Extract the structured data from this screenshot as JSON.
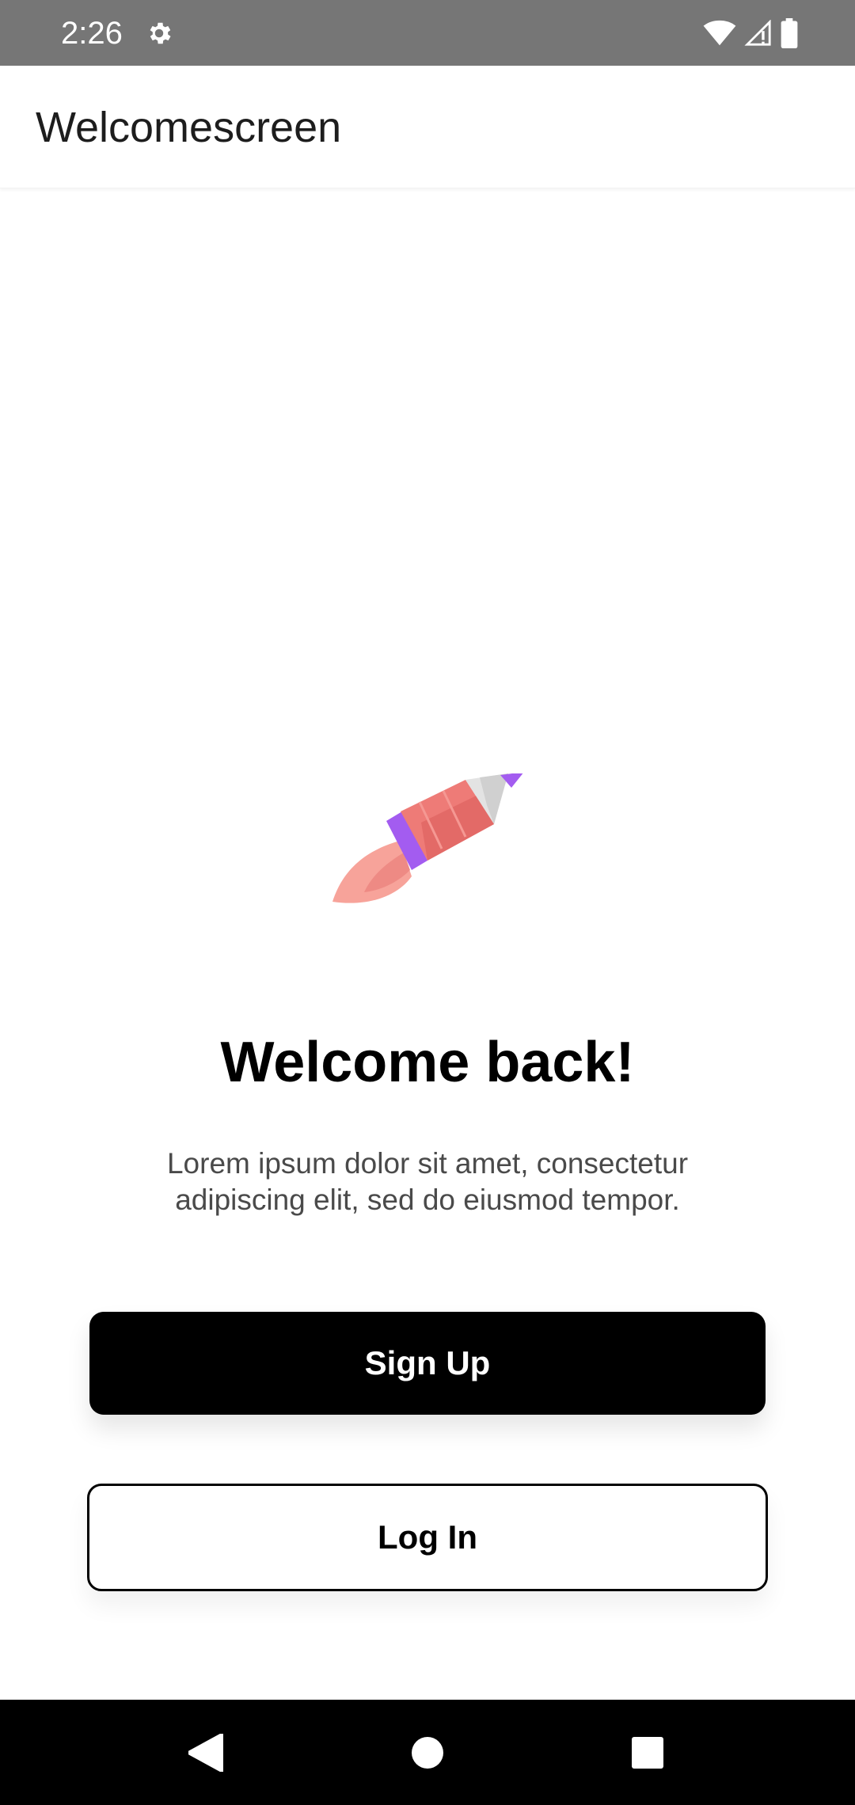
{
  "status_bar": {
    "time": "2:26",
    "settings_icon": "gear-icon",
    "wifi_icon": "wifi-icon",
    "signal_icon": "signal-icon",
    "battery_icon": "battery-icon"
  },
  "app_bar": {
    "title": "Welcomescreen"
  },
  "main": {
    "illustration": "rocket-icon",
    "headline": "Welcome back!",
    "subtext": "Lorem ipsum dolor sit amet, consectetur adipiscing elit, sed do eiusmod tempor.",
    "signup_label": "Sign Up",
    "login_label": "Log In"
  },
  "nav_bar": {
    "back_icon": "back-icon",
    "home_icon": "home-icon",
    "recents_icon": "recents-icon"
  },
  "colors": {
    "status_bar_bg": "#767676",
    "primary_button_bg": "#000000",
    "rocket_body": "#EE7B77",
    "rocket_band": "#A35CF0",
    "rocket_flame": "#F7A39A",
    "rocket_nose": "#E3E3E3"
  }
}
